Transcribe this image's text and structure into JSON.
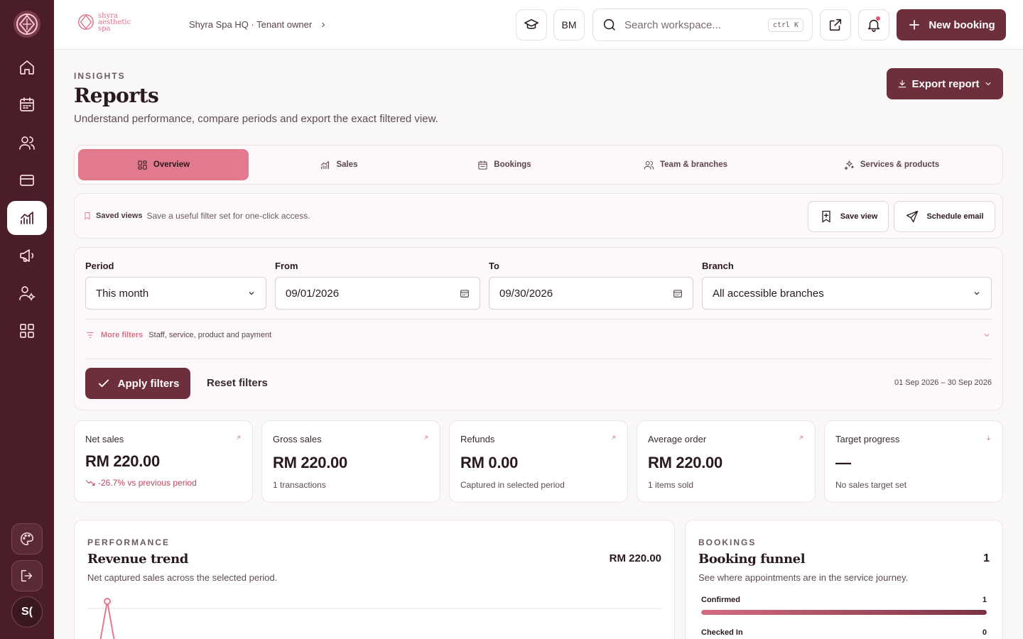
{
  "topbar": {
    "brand_line1": "shyra",
    "brand_line2": "aesthetic",
    "brand_line3": "spa",
    "breadcrumb": "Shyra Spa HQ · Tenant owner",
    "user_initials": "BM",
    "search_placeholder": "Search workspace...",
    "search_shortcut": "ctrl K",
    "new_booking_label": "New booking"
  },
  "sidebar": {
    "items": [
      "home-icon",
      "calendar-icon",
      "users-icon",
      "card-icon",
      "reports-icon",
      "megaphone-icon",
      "user-settings-icon",
      "apps-icon"
    ],
    "active_item": "reports-icon",
    "avatar_initials": "S("
  },
  "header": {
    "eyebrow": "INSIGHTS",
    "title": "Reports",
    "subtitle": "Understand performance, compare periods and export the exact filtered view.",
    "export_label": "Export report"
  },
  "tabs": [
    {
      "label": "Overview",
      "icon": "grid-icon",
      "active": true
    },
    {
      "label": "Sales",
      "icon": "chart-icon",
      "active": false
    },
    {
      "label": "Bookings",
      "icon": "calendar-icon",
      "active": false
    },
    {
      "label": "Team & branches",
      "icon": "users-icon",
      "active": false
    },
    {
      "label": "Services & products",
      "icon": "sparkle-icon",
      "active": false
    }
  ],
  "saved_views": {
    "title": "Saved views",
    "description": "Save a useful filter set for one-click access.",
    "save_view_label": "Save view",
    "schedule_email_label": "Schedule email"
  },
  "filters": {
    "period_label": "Period",
    "period_value": "This month",
    "from_label": "From",
    "from_value": "09/01/2026",
    "to_label": "To",
    "to_value": "09/30/2026",
    "branch_label": "Branch",
    "branch_value": "All accessible branches",
    "more_filters_label": "More filters",
    "more_filters_desc": "Staff, service, product and payment",
    "apply_label": "Apply filters",
    "reset_label": "Reset filters",
    "range_text": "01 Sep 2026 – 30 Sep 2026"
  },
  "metrics": [
    {
      "label": "Net sales",
      "value": "RM 220.00",
      "sub": "-26.7% vs previous period",
      "trend": "down"
    },
    {
      "label": "Gross sales",
      "value": "RM 220.00",
      "sub": "1 transactions"
    },
    {
      "label": "Refunds",
      "value": "RM 0.00",
      "sub": "Captured in selected period"
    },
    {
      "label": "Average order",
      "value": "RM 220.00",
      "sub": "1 items sold"
    },
    {
      "label": "Target progress",
      "value": "—",
      "sub": "No sales target set"
    }
  ],
  "revenue": {
    "eyebrow": "PERFORMANCE",
    "title": "Revenue trend",
    "subtitle": "Net captured sales across the selected period.",
    "total": "RM 220.00"
  },
  "funnel": {
    "eyebrow": "BOOKINGS",
    "title": "Booking funnel",
    "subtitle": "See where appointments are in the service journey.",
    "total": "1",
    "rows": [
      {
        "label": "Confirmed",
        "count": "1",
        "fraction": 1.0
      },
      {
        "label": "Checked In",
        "count": "0",
        "fraction": 0.0
      }
    ]
  },
  "colors": {
    "primary": "#6e2f3d",
    "sidebar": "#4a1d28",
    "accent": "#e07a8c"
  }
}
